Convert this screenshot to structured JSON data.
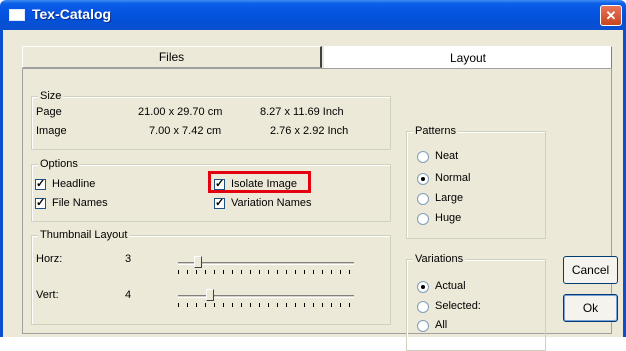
{
  "window": {
    "title": "Tex-Catalog",
    "close_glyph": "✕"
  },
  "tabs": [
    {
      "label": "Files"
    },
    {
      "label": "Layout"
    }
  ],
  "size": {
    "legend": "Size",
    "rows": [
      {
        "label": "Page",
        "cm": "21.00 x 29.70 cm",
        "inch": "8.27 x 11.69 Inch"
      },
      {
        "label": "Image",
        "cm": "7.00 x  7.42 cm",
        "inch": "2.76 x  2.92 Inch"
      }
    ]
  },
  "options": {
    "legend": "Options",
    "items": [
      {
        "label": "Headline",
        "checked": true
      },
      {
        "label": "Isolate Image",
        "checked": true
      },
      {
        "label": "File Names",
        "checked": true
      },
      {
        "label": "Variation Names",
        "checked": true
      }
    ],
    "check_glyph": "✓",
    "highlight_color": "#e3000f"
  },
  "thumbnail": {
    "legend": "Thumbnail Layout",
    "horz": {
      "label": "Horz:",
      "value": "3"
    },
    "vert": {
      "label": "Vert:",
      "value": "4"
    }
  },
  "patterns": {
    "legend": "Patterns",
    "options": [
      "Neat",
      "Normal",
      "Large",
      "Huge"
    ],
    "selected": "Normal"
  },
  "variations": {
    "legend": "Variations",
    "options": [
      "Actual",
      "Selected:",
      "All"
    ],
    "selected": "Actual"
  },
  "buttons": {
    "cancel": "Cancel",
    "ok": "Ok"
  },
  "colors": {
    "titlebar": "#0450d6",
    "dialog_bg": "#ece9d8",
    "accent": "#e3000f"
  }
}
